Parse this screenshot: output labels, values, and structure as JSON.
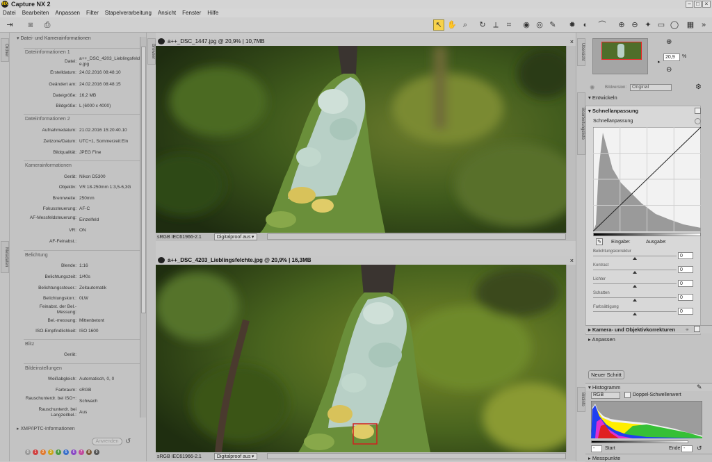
{
  "app": {
    "title": "Capture NX 2"
  },
  "menu": [
    "Datei",
    "Bearbeiten",
    "Anpassen",
    "Filter",
    "Stapelverarbeitung",
    "Ansicht",
    "Fenster",
    "Hilfe"
  ],
  "leftstrip": {
    "tab_top": "Ordner",
    "tab_bottom": "Metadaten"
  },
  "leftpanel": {
    "header": "Datei- und Kamerainformationen",
    "group1": "Dateiinformationen 1",
    "rows1": [
      {
        "label": "Datei:",
        "value": "a++_DSC_4203_Lieblingsfelchte.jpg"
      },
      {
        "label": "Erstelldatum:",
        "value": "24.02.2016 08:48:10"
      },
      {
        "label": "Geändert am:",
        "value": "24.02.2016 08:48:15"
      },
      {
        "label": "Dateigröße:",
        "value": "16,2 MB"
      },
      {
        "label": "Bildgröße:",
        "value": "L (6000 x 4000)"
      }
    ],
    "group2": "Dateiinformationen 2",
    "rows2": [
      {
        "label": "Aufnahmedatum:",
        "value": "21.02.2016 15:20:40.10"
      },
      {
        "label": "Zeitzone/Datum:",
        "value": "UTC+1, Sommerzeit:Ein"
      },
      {
        "label": "Bildqualität:",
        "value": "JPEG Fine"
      }
    ],
    "group3": "Kamerainformationen",
    "rows3": [
      {
        "label": "Gerät:",
        "value": "Nikon D5300"
      },
      {
        "label": "Objektiv:",
        "value": "VR 18-250mm 1:3,5-6,3G"
      },
      {
        "label": "Brennweite:",
        "value": "250mm"
      },
      {
        "label": "Fokussteuerung:",
        "value": "AF-C"
      },
      {
        "label": "AF-Messfeldsteuerung:",
        "value": "Einzelfeld"
      },
      {
        "label": "VR:",
        "value": "ON"
      },
      {
        "label": "AF-Feinabst.:",
        "value": ""
      }
    ],
    "group4": "Belichtung",
    "rows4": [
      {
        "label": "Blende:",
        "value": "1:16"
      },
      {
        "label": "Belichtungszeit:",
        "value": "1/40s"
      },
      {
        "label": "Belichtungssteuer.:",
        "value": "Zeitautomatik"
      },
      {
        "label": "Belichtungskorr.:",
        "value": "0LW"
      },
      {
        "label": "Feinabst. der Bel.-Messung:",
        "value": ""
      },
      {
        "label": "Bel.-messung:",
        "value": "Mittenbetont"
      },
      {
        "label": "ISO-Empfindlichkeit:",
        "value": "ISO 1600"
      }
    ],
    "group5": "Blitz",
    "rows5": [
      {
        "label": "Gerät:",
        "value": ""
      }
    ],
    "group6": "Bildeinstellungen",
    "rows6": [
      {
        "label": "Weißabgleich:",
        "value": "Automatisch, 0, 0"
      },
      {
        "label": "Farbraum:",
        "value": "sRGB"
      },
      {
        "label": "Rauschunterdr. bei ISO+:",
        "value": "Schwach"
      },
      {
        "label": "Rauschunterdr. bei Langzeitbel.:",
        "value": "Aus"
      }
    ],
    "xmp": "XMP/IPTC-Informationen",
    "apply": "Anwenden",
    "label_dots": [
      "0",
      "1",
      "2",
      "3",
      "4",
      "5",
      "6",
      "7",
      "8",
      "9"
    ]
  },
  "browser": {
    "tab": "Browser"
  },
  "window1": {
    "title": "a++_DSC_1447.jpg @ 20,9% | 10,7MB",
    "profile": "sRGB IEC61966-2.1",
    "proof": "Digitalproof aus"
  },
  "window2": {
    "title": "a++_DSC_4203_Lieblingsfelchte.jpg @ 20,9% | 16,3MB",
    "profile": "sRGB IEC61966-2.1",
    "proof": "Digitalproof aus"
  },
  "rightpanel": {
    "tab_overview": "Übersicht",
    "zoom": "20,9",
    "zoom_unit": "%",
    "version_label": "Bildversion:",
    "version_value": "Original",
    "tab_edit": "Bearbeitungsliste",
    "entwickeln": "Entwickeln",
    "quick_header": "Schnellanpassung",
    "quick_sub": "Schnellanpassung",
    "input_label": "Eingabe:",
    "output_label": "Ausgabe:",
    "sliders": [
      {
        "label": "Belichtungskorrektur",
        "value": "0",
        "level": 0.5
      },
      {
        "label": "Kontrast",
        "value": "0",
        "level": 0.5
      },
      {
        "label": "Lichter",
        "value": "0",
        "level": 0.5
      },
      {
        "label": "Schatten",
        "value": "0",
        "level": 0.5
      },
      {
        "label": "Farbsättigung",
        "value": "0",
        "level": 0.5
      }
    ],
    "camera_corr": "Kamera- und Objektivkorrekturen",
    "anpassen": "Anpassen",
    "new_step": "Neuer Schritt",
    "tab_photo": "Bildinfo",
    "histogram": "Histogramm",
    "channel": "RGB",
    "dual_threshold": "Doppel-Schwellenwert",
    "start_label": "Start",
    "end_label": "Ende",
    "start_value": "-",
    "end_value": "-",
    "messpunkte": "Messpunkte"
  }
}
